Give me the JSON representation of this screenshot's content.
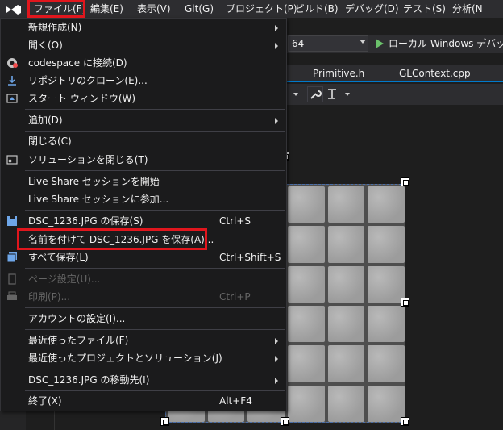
{
  "menubar": {
    "items": [
      "ファイル(F)",
      "編集(E)",
      "表示(V)",
      "Git(G)",
      "プロジェクト(P)",
      "ビルド(B)",
      "デバッグ(D)",
      "テスト(S)",
      "分析(N"
    ]
  },
  "toolbar": {
    "config_value": "64",
    "debug_label": "ローカル Windows デバッガー"
  },
  "tabs": [
    "Primitive.h",
    "GLContext.cpp"
  ],
  "file_menu": {
    "items": [
      {
        "label": "新規作成(N)",
        "shortcut": "",
        "submenu": true,
        "icon": ""
      },
      {
        "label": "開く(O)",
        "shortcut": "",
        "submenu": true,
        "icon": ""
      },
      {
        "label": "codespace に接続(D)",
        "shortcut": "",
        "submenu": false,
        "icon": "codespace-icon"
      },
      {
        "label": "リポジトリのクローン(E)...",
        "shortcut": "",
        "submenu": false,
        "icon": "clone-icon"
      },
      {
        "label": "スタート ウィンドウ(W)",
        "shortcut": "",
        "submenu": false,
        "icon": "start-window-icon"
      },
      {
        "label": "追加(D)",
        "shortcut": "",
        "submenu": true,
        "icon": ""
      },
      {
        "label": "閉じる(C)",
        "shortcut": "",
        "submenu": false,
        "icon": ""
      },
      {
        "label": "ソリューションを閉じる(T)",
        "shortcut": "",
        "submenu": false,
        "icon": "close-solution-icon"
      },
      {
        "label": "Live Share セッションを開始",
        "shortcut": "",
        "submenu": false,
        "icon": ""
      },
      {
        "label": "Live Share セッションに参加...",
        "shortcut": "",
        "submenu": false,
        "icon": ""
      },
      {
        "label": "DSC_1236.JPG の保存(S)",
        "shortcut": "Ctrl+S",
        "submenu": false,
        "icon": "save-icon"
      },
      {
        "label": "名前を付けて DSC_1236.JPG を保存(A)...",
        "shortcut": "",
        "submenu": false,
        "icon": ""
      },
      {
        "label": "すべて保存(L)",
        "shortcut": "Ctrl+Shift+S",
        "submenu": false,
        "icon": "save-all-icon"
      },
      {
        "label": "ページ設定(U)...",
        "shortcut": "",
        "submenu": false,
        "icon": "page-setup-icon",
        "disabled": true
      },
      {
        "label": "印刷(P)...",
        "shortcut": "Ctrl+P",
        "submenu": false,
        "icon": "print-icon",
        "disabled": true
      },
      {
        "label": "アカウントの設定(I)...",
        "shortcut": "",
        "submenu": false,
        "icon": ""
      },
      {
        "label": "最近使ったファイル(F)",
        "shortcut": "",
        "submenu": true,
        "icon": ""
      },
      {
        "label": "最近使ったプロジェクトとソリューション(J)",
        "shortcut": "",
        "submenu": true,
        "icon": ""
      },
      {
        "label": "DSC_1236.JPG の移動先(I)",
        "shortcut": "",
        "submenu": true,
        "icon": ""
      },
      {
        "label": "終了(X)",
        "shortcut": "Alt+F4",
        "submenu": false,
        "icon": ""
      }
    ]
  },
  "colors": {
    "highlight": "#e0161d",
    "menu_bg": "#1b1b1c",
    "accent": "#007acc"
  }
}
